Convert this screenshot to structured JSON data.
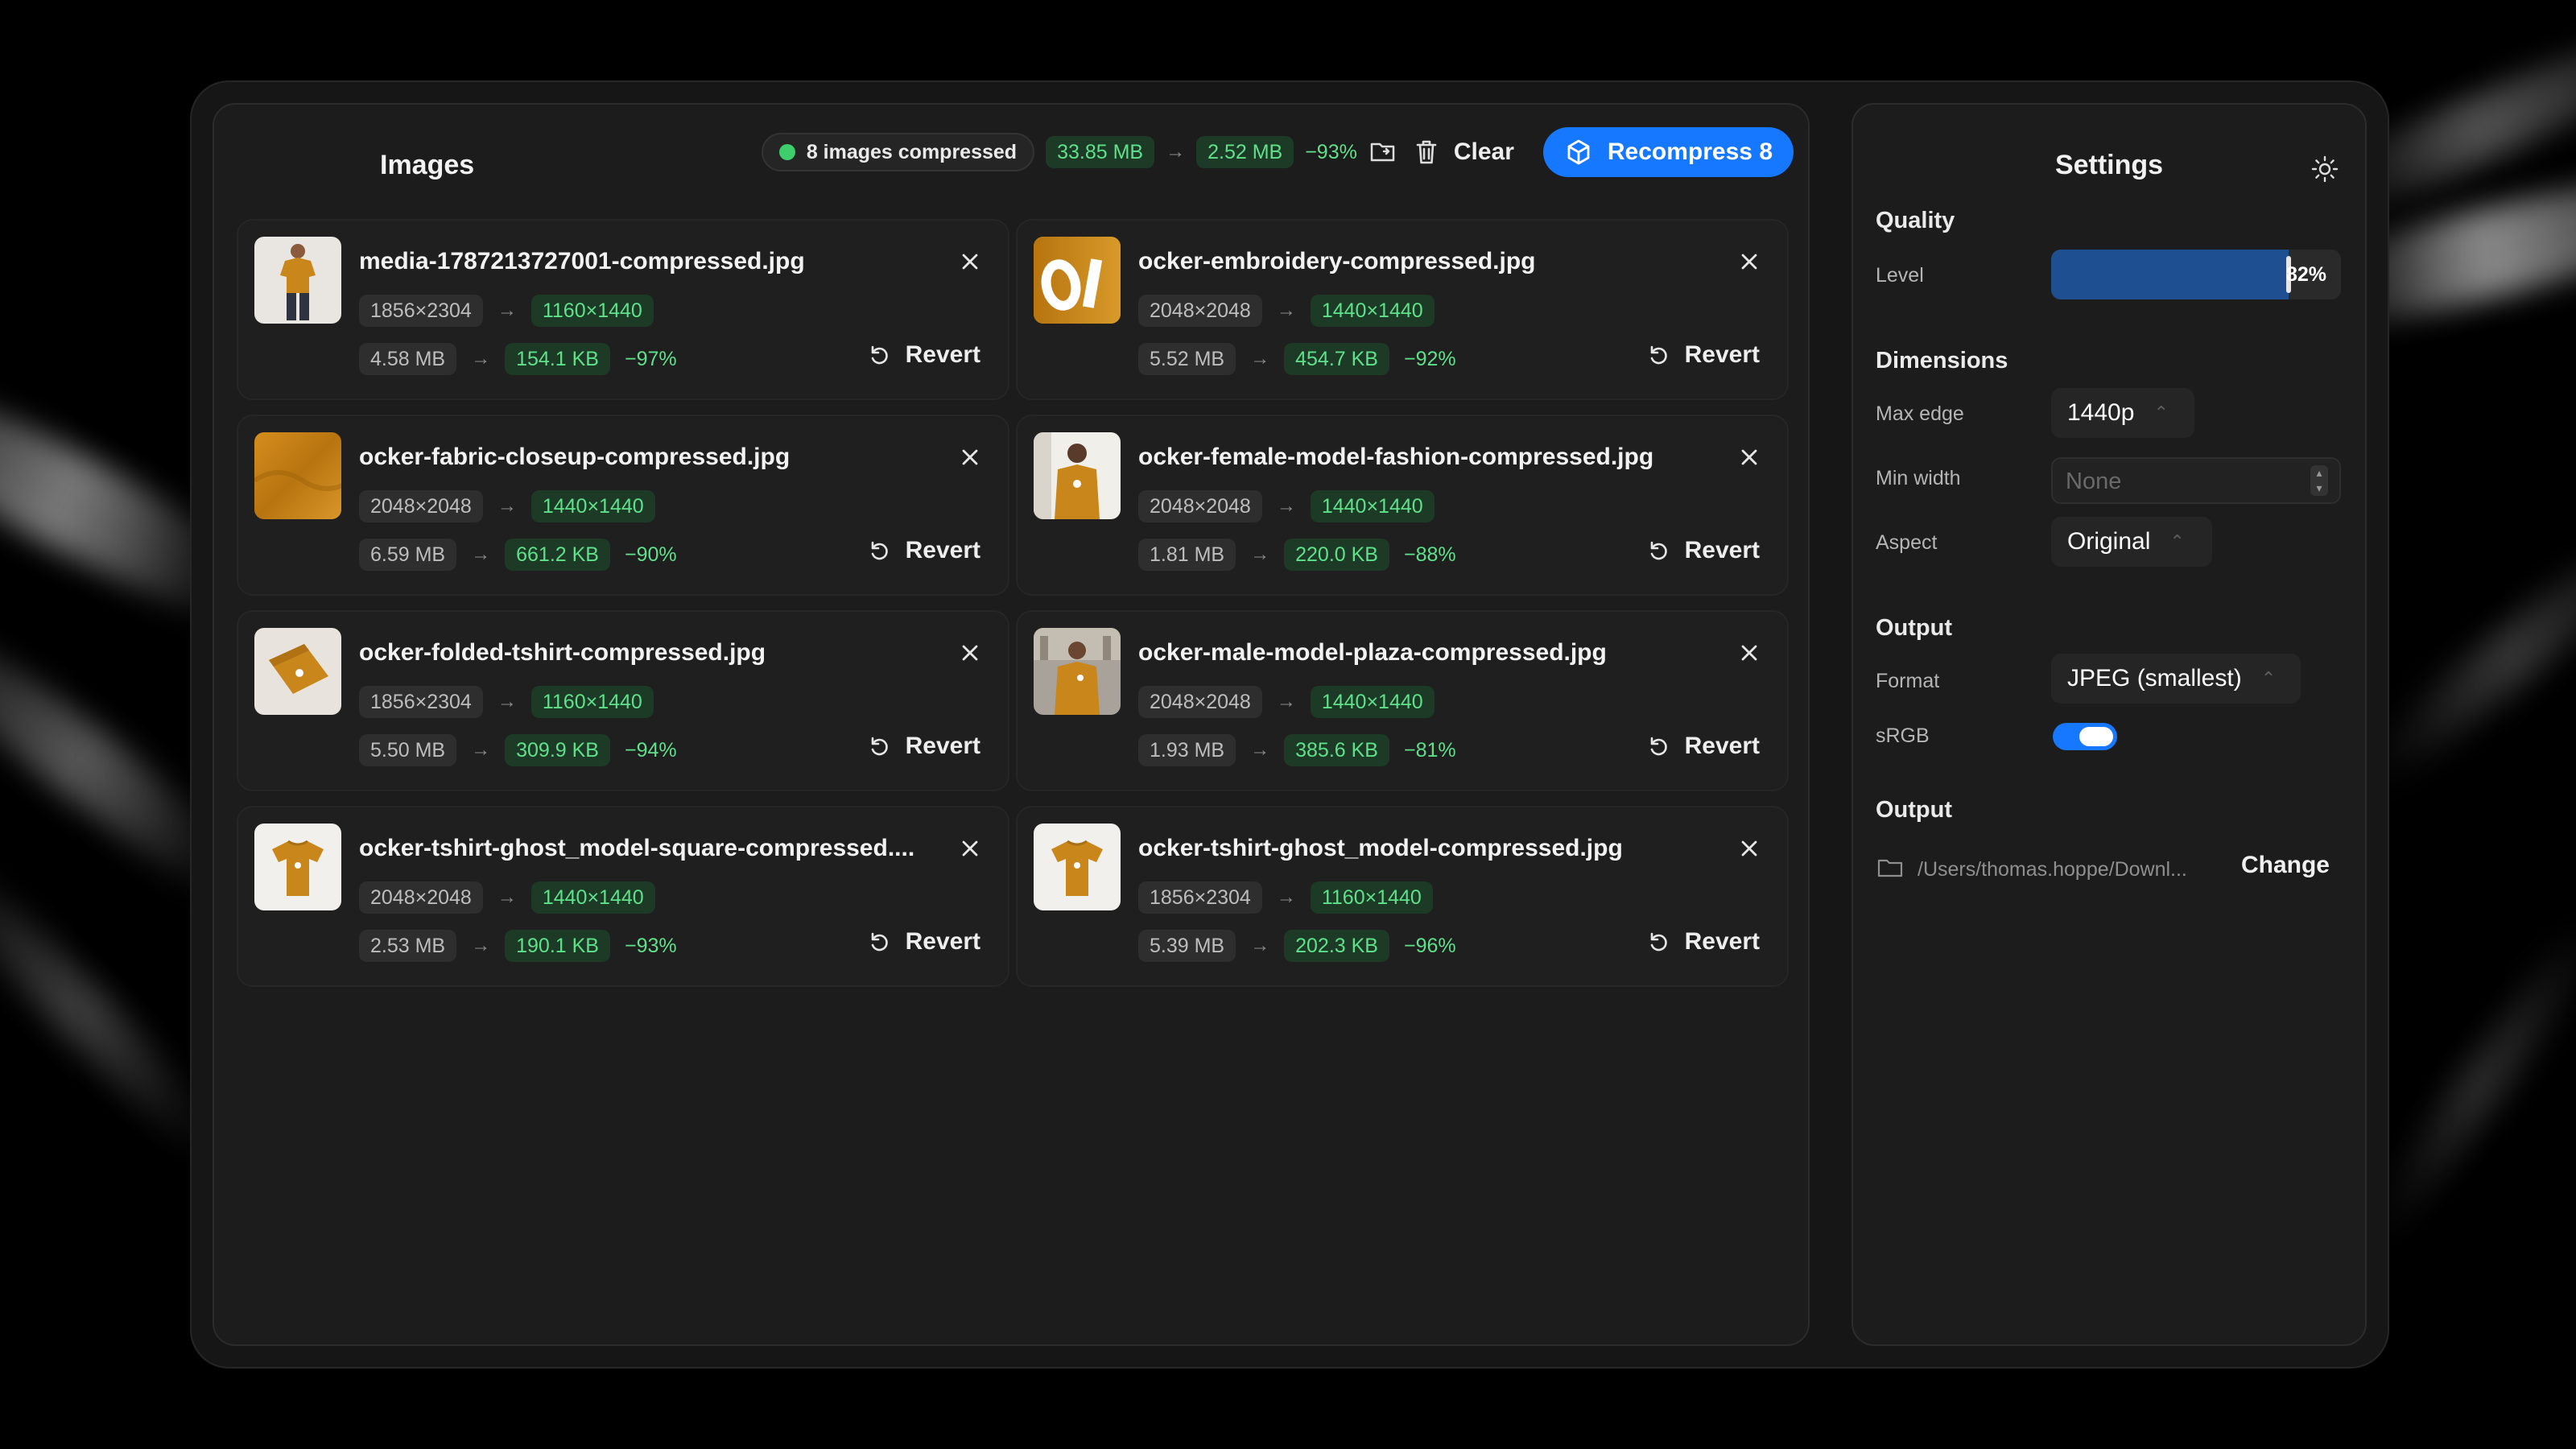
{
  "header": {
    "title": "Images",
    "status": "8 images compressed",
    "size_before": "33.85 MB",
    "size_after": "2.52 MB",
    "size_change": "−93%",
    "clear_label": "Clear",
    "recompress_label": "Recompress 8"
  },
  "images": [
    {
      "name": "media-1787213727001-compressed.jpg",
      "dim_before": "1856×2304",
      "dim_after": "1160×1440",
      "size_before": "4.58 MB",
      "size_after": "154.1 KB",
      "change": "−97%",
      "revert": "Revert",
      "thumb": "model-tshirt"
    },
    {
      "name": "ocker-embroidery-compressed.jpg",
      "dim_before": "2048×2048",
      "dim_after": "1440×1440",
      "size_before": "5.52 MB",
      "size_after": "454.7 KB",
      "change": "−92%",
      "revert": "Revert",
      "thumb": "embroidery"
    },
    {
      "name": "ocker-fabric-closeup-compressed.jpg",
      "dim_before": "2048×2048",
      "dim_after": "1440×1440",
      "size_before": "6.59 MB",
      "size_after": "661.2 KB",
      "change": "−90%",
      "revert": "Revert",
      "thumb": "fabric"
    },
    {
      "name": "ocker-female-model-fashion-compressed.jpg",
      "dim_before": "2048×2048",
      "dim_after": "1440×1440",
      "size_before": "1.81 MB",
      "size_after": "220.0 KB",
      "change": "−88%",
      "revert": "Revert",
      "thumb": "female-model"
    },
    {
      "name": "ocker-folded-tshirt-compressed.jpg",
      "dim_before": "1856×2304",
      "dim_after": "1160×1440",
      "size_before": "5.50 MB",
      "size_after": "309.9 KB",
      "change": "−94%",
      "revert": "Revert",
      "thumb": "folded-tshirt"
    },
    {
      "name": "ocker-male-model-plaza-compressed.jpg",
      "dim_before": "2048×2048",
      "dim_after": "1440×1440",
      "size_before": "1.93 MB",
      "size_after": "385.6 KB",
      "change": "−81%",
      "revert": "Revert",
      "thumb": "male-model"
    },
    {
      "name": "ocker-tshirt-ghost_model-square-compressed....",
      "dim_before": "2048×2048",
      "dim_after": "1440×1440",
      "size_before": "2.53 MB",
      "size_after": "190.1 KB",
      "change": "−93%",
      "revert": "Revert",
      "thumb": "tshirt"
    },
    {
      "name": "ocker-tshirt-ghost_model-compressed.jpg",
      "dim_before": "1856×2304",
      "dim_after": "1160×1440",
      "size_before": "5.39 MB",
      "size_after": "202.3 KB",
      "change": "−96%",
      "revert": "Revert",
      "thumb": "tshirt"
    }
  ],
  "settings": {
    "title": "Settings",
    "quality": {
      "section": "Quality",
      "level_label": "Level",
      "level_value": 82,
      "level_text": "82%"
    },
    "dimensions": {
      "section": "Dimensions",
      "max_edge_label": "Max edge",
      "max_edge_value": "1440p",
      "min_width_label": "Min width",
      "min_width_placeholder": "None",
      "aspect_label": "Aspect",
      "aspect_value": "Original"
    },
    "output_format": {
      "section": "Output",
      "format_label": "Format",
      "format_value": "JPEG (smallest)",
      "srgb_label": "sRGB",
      "srgb_on": true
    },
    "output_path": {
      "section": "Output",
      "path": "/Users/thomas.hoppe/Downl...",
      "change_label": "Change"
    }
  },
  "colors": {
    "accent": "#1677ff",
    "success": "#5fe08a",
    "slider_fill": "#1d4f91",
    "ochre": "#c9861a"
  }
}
